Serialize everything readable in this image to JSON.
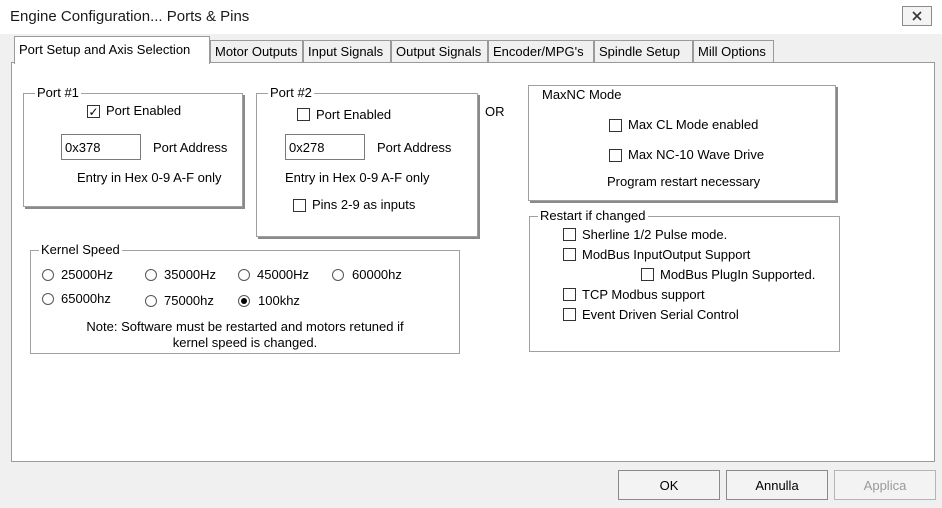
{
  "window": {
    "title": "Engine Configuration... Ports & Pins"
  },
  "tabs": [
    "Port Setup and Axis Selection",
    "Motor Outputs",
    "Input Signals",
    "Output Signals",
    "Encoder/MPG's",
    "Spindle Setup",
    "Mill Options"
  ],
  "port1": {
    "legend": "Port #1",
    "enabled_label": "Port Enabled",
    "enabled": true,
    "address_value": "0x378",
    "address_label": "Port Address",
    "hint": "Entry in Hex 0-9 A-F only"
  },
  "port2": {
    "legend": "Port #2",
    "enabled_label": "Port Enabled",
    "enabled": false,
    "address_value": "0x278",
    "address_label": "Port Address",
    "hint": "Entry in Hex 0-9 A-F only",
    "pins_label": "Pins 2-9 as inputs",
    "pins_checked": false
  },
  "or_label": "OR",
  "maxnc": {
    "legend": "MaxNC Mode",
    "cl_mode_label": "Max CL Mode enabled",
    "wave_drive_label": "Max NC-10 Wave Drive",
    "restart_note": "Program restart necessary"
  },
  "kernel": {
    "legend": "Kernel Speed",
    "options": [
      "25000Hz",
      "35000Hz",
      "45000Hz",
      "60000hz",
      "65000hz",
      "75000hz",
      "100khz"
    ],
    "selected": "100khz",
    "note_line1": "Note: Software must be restarted and motors retuned if",
    "note_line2": "kernel speed is changed."
  },
  "restart": {
    "legend": "Restart if changed",
    "sherline_label": "Sherline 1/2 Pulse mode.",
    "modbus_io_label": "ModBus InputOutput Support",
    "modbus_plugin_label": "ModBus PlugIn Supported.",
    "tcp_modbus_label": "TCP Modbus support",
    "event_serial_label": "Event Driven Serial Control"
  },
  "buttons": {
    "ok": "OK",
    "cancel": "Annulla",
    "apply": "Applica"
  }
}
